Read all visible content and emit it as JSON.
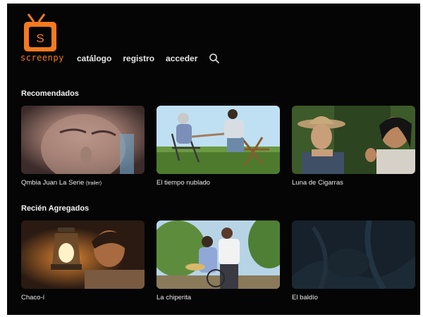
{
  "brand": {
    "logo_letter": "S",
    "name": "screenpy",
    "accent": "#f47a20"
  },
  "nav": {
    "items": [
      "catálogo",
      "registro",
      "acceder"
    ],
    "search_icon": "search-icon"
  },
  "sections": [
    {
      "title": "Recomendados",
      "items": [
        {
          "title": "Qmbia Juan La Serie",
          "tag": "(trailer)"
        },
        {
          "title": "El tiempo nublado",
          "tag": ""
        },
        {
          "title": "Luna de Cigarras",
          "tag": ""
        }
      ]
    },
    {
      "title": "Recién Agregados",
      "items": [
        {
          "title": "Chaco-í",
          "tag": ""
        },
        {
          "title": "La chiperita",
          "tag": ""
        },
        {
          "title": "El baldío",
          "tag": ""
        }
      ]
    }
  ],
  "colors": {
    "background": "#050505",
    "text": "#eaeaea"
  }
}
